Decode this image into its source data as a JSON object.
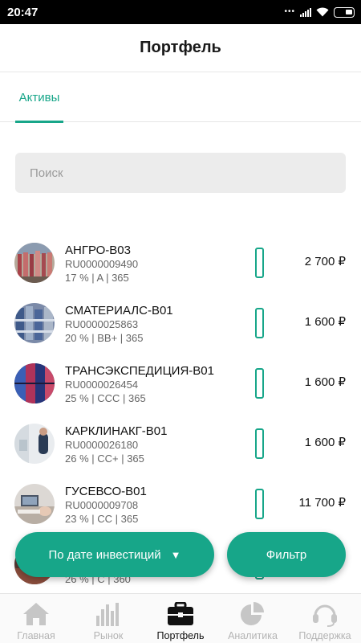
{
  "status_bar": {
    "time": "20:47"
  },
  "header": {
    "title": "Портфель"
  },
  "tabs": [
    {
      "label": "Активы",
      "active": true
    }
  ],
  "search": {
    "placeholder": "Поиск",
    "value": ""
  },
  "assets": [
    {
      "name": "АНГРО-В03",
      "code": "RU0000009490",
      "meta": "17 % | A | 365",
      "price": "2 700 ₽",
      "progress": 0,
      "image": "meat-shop"
    },
    {
      "name": "СМАТЕРИАЛС-В01",
      "code": "RU0000025863",
      "meta": "20 % | BB+ | 365",
      "price": "1 600 ₽",
      "progress": 0,
      "image": "warehouse"
    },
    {
      "name": "ТРАНСЭКСПЕДИЦИЯ-В01",
      "code": "RU0000026454",
      "meta": "25 % | CCC | 365",
      "price": "1 600 ₽",
      "progress": 0,
      "image": "containers"
    },
    {
      "name": "КАРКЛИНАКГ-В01",
      "code": "RU0000026180",
      "meta": "26 % | CC+ | 365",
      "price": "1 600 ₽",
      "progress": 0,
      "image": "clinic"
    },
    {
      "name": "ГУСЕВСО-В01",
      "code": "RU0000009708",
      "meta": "23 % | CC | 365",
      "price": "11 700 ₽",
      "progress": 0,
      "image": "office"
    },
    {
      "name": "",
      "code": "",
      "meta": "26 % | C | 360",
      "price": "",
      "progress": 0,
      "image": "partial"
    }
  ],
  "buttons": {
    "sort_label": "По дате инвестиций",
    "sort_caret": "▼",
    "filter_label": "Фильтр"
  },
  "bottom_nav": [
    {
      "label": "Главная",
      "icon": "home-icon",
      "active": false
    },
    {
      "label": "Рынок",
      "icon": "market-chart-icon",
      "active": false
    },
    {
      "label": "Портфель",
      "icon": "briefcase-icon",
      "active": true
    },
    {
      "label": "Аналитика",
      "icon": "pie-chart-icon",
      "active": false
    },
    {
      "label": "Поддержка",
      "icon": "headset-icon",
      "active": false
    }
  ],
  "colors": {
    "accent": "#17a689",
    "nav_inactive": "#b4b4b4",
    "nav_active": "#111111",
    "search_bg": "#ececec"
  }
}
